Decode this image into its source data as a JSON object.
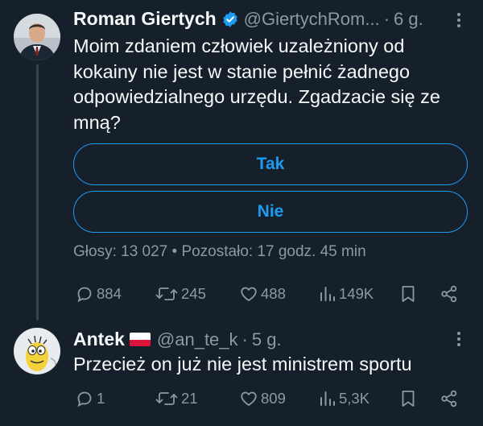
{
  "tweet": {
    "name": "Roman Giertych",
    "handle": "@GiertychRom...",
    "time": "6 g.",
    "text_lines": [
      "Moim zdaniem człowiek uzależniony od",
      "kokainy nie jest w stanie pełnić żadnego",
      "odpowiedzialnego urzędu. Zgadzacie się ze",
      "mną?"
    ],
    "poll": {
      "options": [
        "Tak",
        "Nie"
      ],
      "summary": "Głosy: 13 027 • Pozostało: 17 godz. 45 min"
    },
    "actions": {
      "replies": "884",
      "reposts": "245",
      "likes": "488",
      "views": "149K"
    }
  },
  "reply": {
    "name": "Antek",
    "flag": "🇵🇱",
    "handle": "@an_te_k",
    "time": "5 g.",
    "text": "Przecież on już nie jest ministrem sportu",
    "actions": {
      "replies": "1",
      "reposts": "21",
      "likes": "809",
      "views": "5,3K"
    }
  },
  "colors": {
    "background": "#15202b",
    "accent": "#1d9bf0",
    "muted": "#8b98a5",
    "text": "#f7f9f9",
    "line": "#38444d"
  },
  "icons": [
    "verified-badge-icon",
    "more-icon",
    "reply-icon",
    "repost-icon",
    "like-icon",
    "views-icon",
    "bookmark-icon",
    "share-icon"
  ]
}
